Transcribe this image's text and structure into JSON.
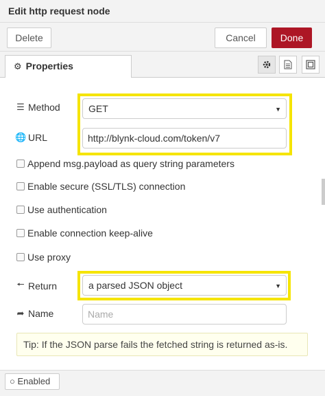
{
  "header": {
    "title": "Edit http request node"
  },
  "toolbar": {
    "delete_label": "Delete",
    "cancel_label": "Cancel",
    "done_label": "Done"
  },
  "tabs": {
    "properties_label": "Properties"
  },
  "form": {
    "method": {
      "label": "Method",
      "value": "GET"
    },
    "url": {
      "label": "URL",
      "value": "http://blynk-cloud.com/token/v7"
    },
    "checkboxes": [
      {
        "label": "Append msg.payload as query string parameters",
        "checked": false
      },
      {
        "label": "Enable secure (SSL/TLS) connection",
        "checked": false
      },
      {
        "label": "Use authentication",
        "checked": false
      },
      {
        "label": "Enable connection keep-alive",
        "checked": false
      },
      {
        "label": "Use proxy",
        "checked": false
      }
    ],
    "return": {
      "label": "Return",
      "value": "a parsed JSON object"
    },
    "name": {
      "label": "Name",
      "placeholder": "Name",
      "value": ""
    },
    "tip": "Tip: If the JSON parse fails the fetched string is returned as-is."
  },
  "footer": {
    "enabled_label": "Enabled"
  },
  "colors": {
    "done": "#ad1625",
    "highlight": "#f5e400",
    "tip_bg": "#ffffee"
  }
}
